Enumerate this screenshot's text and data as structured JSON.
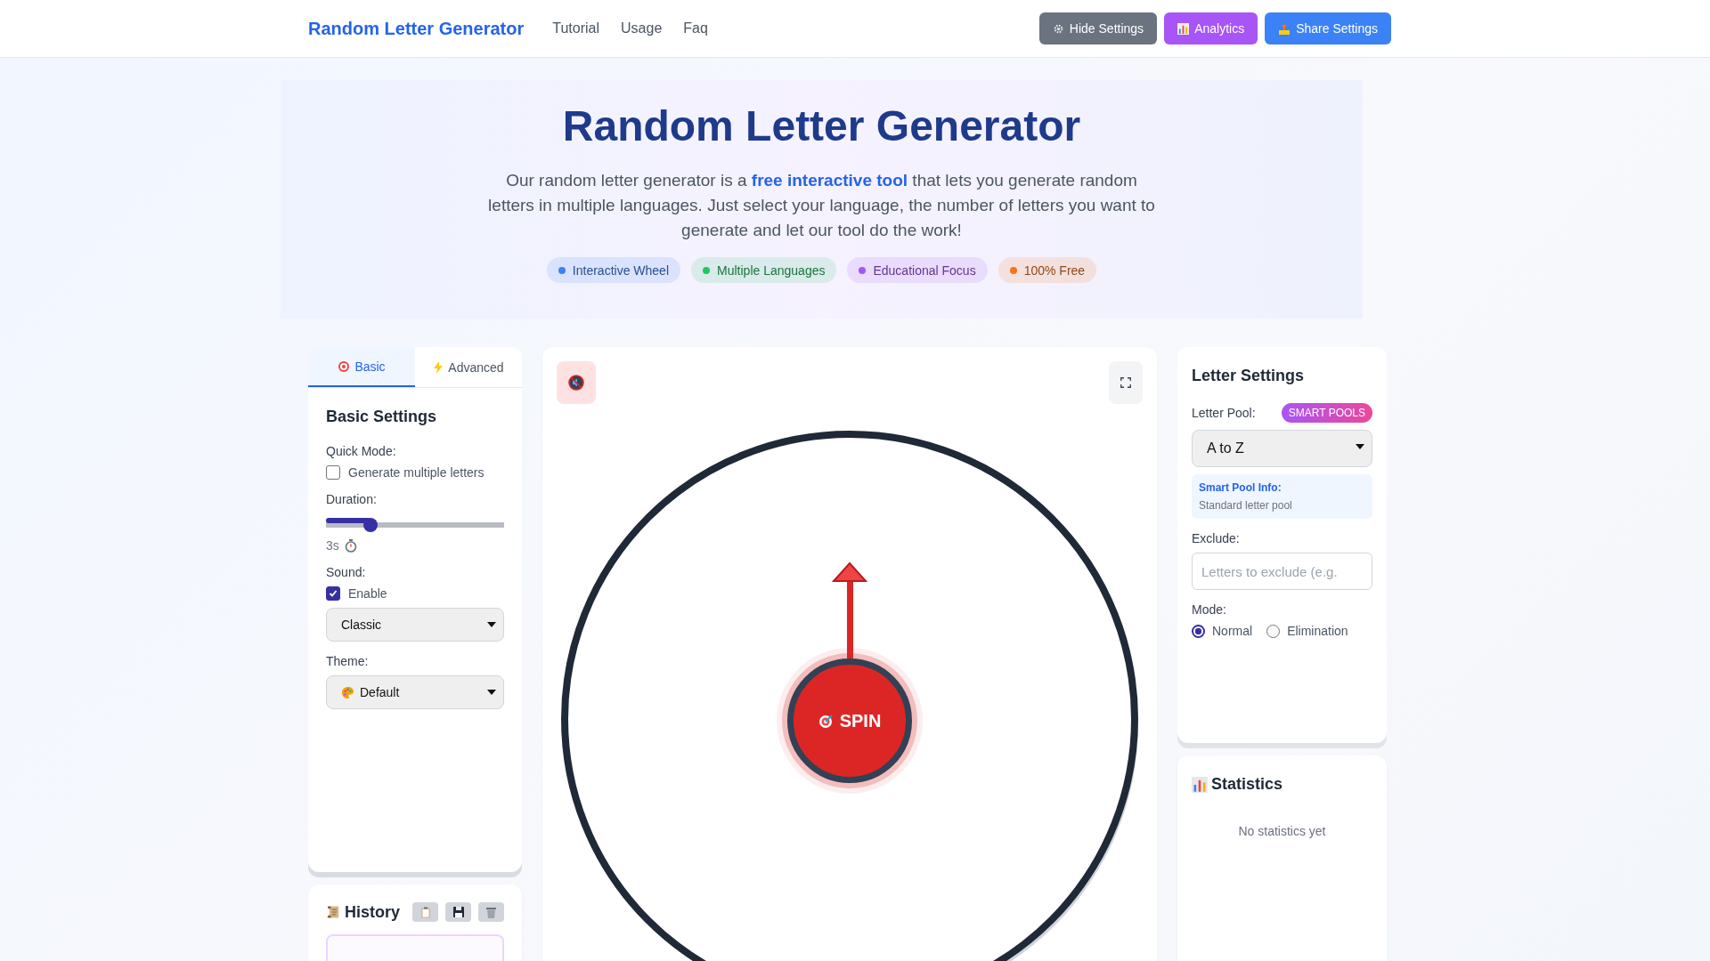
{
  "header": {
    "brand": "Random Letter Generator",
    "nav": [
      "Tutorial",
      "Usage",
      "Faq"
    ],
    "buttons": [
      {
        "label": "Hide Settings",
        "kind": "gear"
      },
      {
        "label": "Analytics",
        "kind": "chart"
      },
      {
        "label": "Share Settings",
        "kind": "share"
      }
    ]
  },
  "hero": {
    "title": "Random Letter Generator",
    "description": "Our random letter generator is a **free interactive tool** that lets you generate random letters in multiple languages. Just select your language, the number of letters you want to generate and let our tool do the work!",
    "badges": [
      {
        "label": "Interactive Wheel",
        "color": "#3b82f6"
      },
      {
        "label": "Multiple Languages",
        "color": "#22c55e"
      },
      {
        "label": "Educational Focus",
        "color": "#a855f7"
      },
      {
        "label": "100% Free",
        "color": "#f97316"
      }
    ]
  },
  "left_panel": {
    "tabs": [
      {
        "label": "Basic",
        "kind": "target",
        "selected": true
      },
      {
        "label": "Advanced",
        "kind": "bolt",
        "selected": false
      }
    ],
    "heading": "Basic Settings",
    "quick_mode": {
      "label": "Quick Mode:",
      "option": "Generate multiple letters",
      "checked": false
    },
    "duration": {
      "label": "Duration:",
      "level": 0.25,
      "reading": "3s"
    },
    "sound": {
      "label": "Sound:",
      "option": "Enable",
      "checked": true,
      "select": "Classic"
    },
    "theme": {
      "label": "Theme:",
      "select": "Default"
    }
  },
  "history": {
    "title": "History"
  },
  "wheel": {
    "muted": true,
    "spin_label": "SPIN"
  },
  "letter_settings": {
    "title": "Letter Settings",
    "pool_label": "Letter Pool:",
    "pool_badge": "SMART POOLS",
    "pool_select": "A to Z",
    "info_title": "Smart Pool Info:",
    "info_text": "Standard letter pool",
    "exclude_label": "Exclude:",
    "exclude_placeholder": "Letters to exclude (e.g.",
    "mode_label": "Mode:",
    "modes": [
      {
        "label": "Normal",
        "selected": true
      },
      {
        "label": "Elimination",
        "selected": false
      }
    ]
  },
  "statistics": {
    "title": "Statistics",
    "empty": "No statistics yet"
  }
}
